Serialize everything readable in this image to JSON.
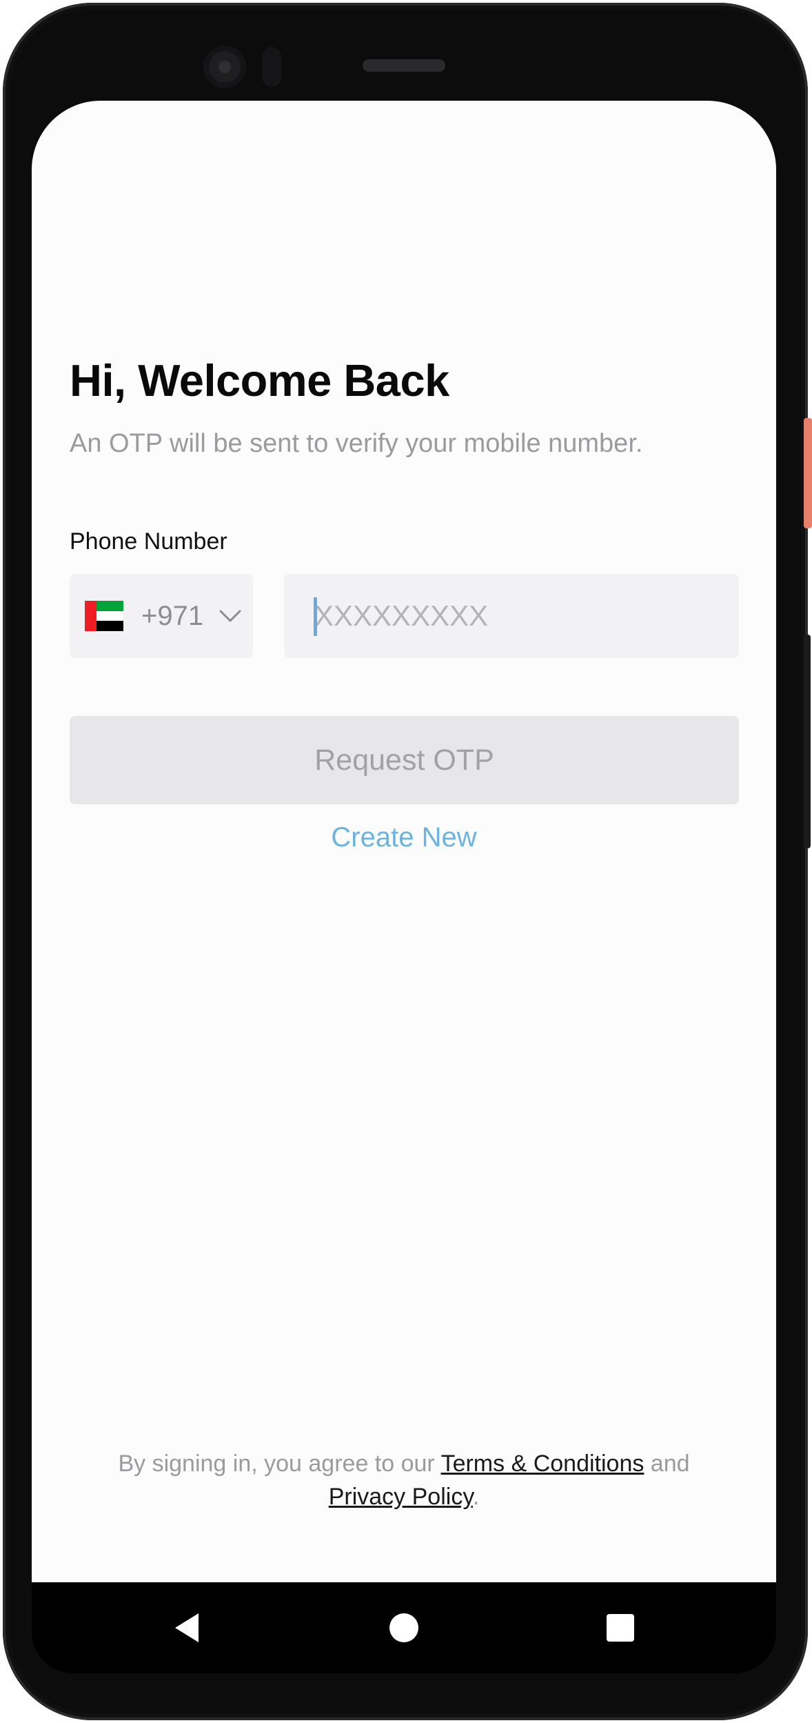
{
  "screen": {
    "title": "Hi, Welcome Back",
    "subtitle": "An OTP will be sent to verify your mobile number."
  },
  "phone": {
    "label": "Phone Number",
    "country_flag": "uae-flag-icon",
    "dial_code": "+971",
    "placeholder": "XXXXXXXXX",
    "value": ""
  },
  "actions": {
    "request_otp": "Request OTP",
    "create_new": "Create New"
  },
  "footer": {
    "prefix": "By signing in, you agree to our ",
    "terms": "Terms & Conditions",
    "and": " and",
    "privacy": "Privacy Policy",
    "suffix": "."
  },
  "navbar": {
    "back": "back-icon",
    "home": "home-icon",
    "recents": "recents-icon"
  },
  "colors": {
    "link": "#6cb3e0",
    "button_disabled_bg": "#e7e7ea",
    "input_bg": "#f2f2f4",
    "power_button": "#e7806a"
  }
}
